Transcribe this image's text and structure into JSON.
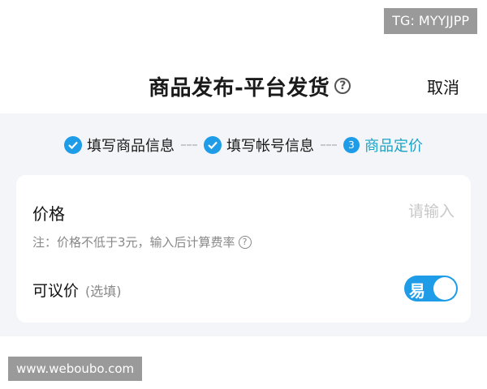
{
  "watermark_top": "TG: MYYJJPP",
  "watermark_bottom": "www.weboubo.com",
  "header": {
    "title": "商品发布-平台发货",
    "help_icon": "question-circle-icon",
    "cancel_label": "取消"
  },
  "steps": [
    {
      "label": "填写商品信息",
      "state": "done"
    },
    {
      "label": "填写帐号信息",
      "state": "done"
    },
    {
      "number": "3",
      "label": "商品定价",
      "state": "active"
    }
  ],
  "form": {
    "price_label": "价格",
    "price_placeholder": "请输入",
    "price_value": "",
    "note": "注：价格不低于3元，输入后计算费率",
    "negotiable_label": "可议价",
    "negotiable_hint": "(选填)",
    "toggle_text": "易",
    "toggle_on": true
  },
  "colors": {
    "accent": "#1e9ce8",
    "active_step": "#1aa3c6",
    "background": "#f3f5f8"
  }
}
